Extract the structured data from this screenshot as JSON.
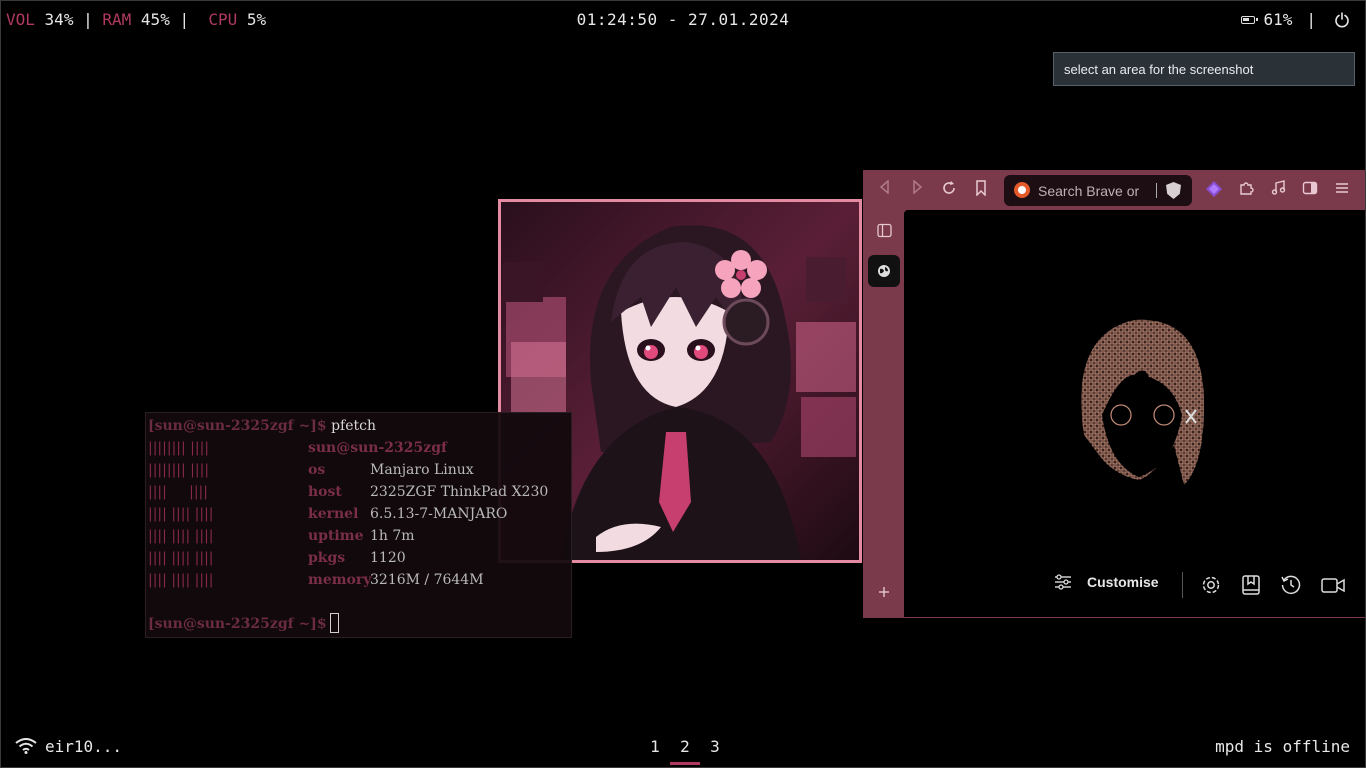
{
  "statusbar": {
    "vol_label": "VOL",
    "vol_value": "34%",
    "ram_label": "RAM",
    "ram_value": "45%",
    "cpu_label": "CPU",
    "cpu_value": "5%",
    "separator": "|",
    "clock": "01:24:50 - 27.01.2024",
    "battery": "61%",
    "power_icon": "power-icon",
    "battery_icon": "battery-icon",
    "accent": "#b03a5f"
  },
  "notification": {
    "text": "select an area for the screenshot"
  },
  "terminal": {
    "prompt": "[sun@sun-2325zgf ~]$",
    "command": "pfetch",
    "userhost": "sun@sun-2325zgf",
    "logo": [
      "|||||||| ||||",
      "|||||||| ||||",
      "||||     ||||",
      "|||| |||| ||||",
      "|||| |||| ||||",
      "|||| |||| ||||",
      "|||| |||| ||||"
    ],
    "info": [
      {
        "key": "os",
        "value": "Manjaro Linux"
      },
      {
        "key": "host",
        "value": "2325ZGF ThinkPad X230"
      },
      {
        "key": "kernel",
        "value": "6.5.13-7-MANJARO"
      },
      {
        "key": "uptime",
        "value": "1h 7m"
      },
      {
        "key": "pkgs",
        "value": "1120"
      },
      {
        "key": "memory",
        "value": "3216M / 7644M"
      }
    ],
    "accent": "#7b2e47"
  },
  "browser": {
    "search_placeholder": "Search Brave or",
    "customise_label": "Customise",
    "toolbar_icons": [
      "back-icon",
      "forward-icon",
      "reload-icon",
      "bookmark-icon",
      "brave-shield-icon",
      "rewards-icon",
      "extensions-icon",
      "media-icon",
      "sidebar-toggle-icon",
      "menu-icon"
    ],
    "sidebar_icons": [
      "panel-icon",
      "globe-icon",
      "add-icon"
    ],
    "page_icons": [
      "settings-icon",
      "bookmarks-icon",
      "history-icon",
      "video-icon"
    ],
    "frame_color": "#7a3a4c"
  },
  "bottombar": {
    "network": "eir10...",
    "workspaces": [
      "1",
      "2",
      "3"
    ],
    "active_workspace": "2",
    "mpd_status": "mpd is offline"
  }
}
